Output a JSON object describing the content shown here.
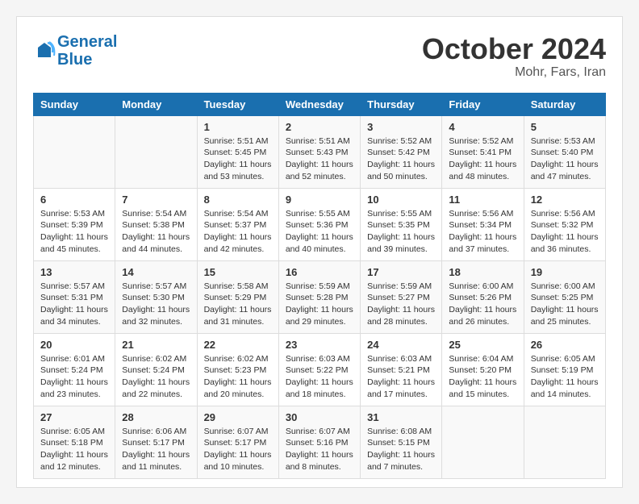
{
  "header": {
    "logo_general": "General",
    "logo_blue": "Blue",
    "month": "October 2024",
    "location": "Mohr, Fars, Iran"
  },
  "days_of_week": [
    "Sunday",
    "Monday",
    "Tuesday",
    "Wednesday",
    "Thursday",
    "Friday",
    "Saturday"
  ],
  "weeks": [
    [
      {
        "day": "",
        "info": ""
      },
      {
        "day": "",
        "info": ""
      },
      {
        "day": "1",
        "info": "Sunrise: 5:51 AM\nSunset: 5:45 PM\nDaylight: 11 hours\nand 53 minutes."
      },
      {
        "day": "2",
        "info": "Sunrise: 5:51 AM\nSunset: 5:43 PM\nDaylight: 11 hours\nand 52 minutes."
      },
      {
        "day": "3",
        "info": "Sunrise: 5:52 AM\nSunset: 5:42 PM\nDaylight: 11 hours\nand 50 minutes."
      },
      {
        "day": "4",
        "info": "Sunrise: 5:52 AM\nSunset: 5:41 PM\nDaylight: 11 hours\nand 48 minutes."
      },
      {
        "day": "5",
        "info": "Sunrise: 5:53 AM\nSunset: 5:40 PM\nDaylight: 11 hours\nand 47 minutes."
      }
    ],
    [
      {
        "day": "6",
        "info": "Sunrise: 5:53 AM\nSunset: 5:39 PM\nDaylight: 11 hours\nand 45 minutes."
      },
      {
        "day": "7",
        "info": "Sunrise: 5:54 AM\nSunset: 5:38 PM\nDaylight: 11 hours\nand 44 minutes."
      },
      {
        "day": "8",
        "info": "Sunrise: 5:54 AM\nSunset: 5:37 PM\nDaylight: 11 hours\nand 42 minutes."
      },
      {
        "day": "9",
        "info": "Sunrise: 5:55 AM\nSunset: 5:36 PM\nDaylight: 11 hours\nand 40 minutes."
      },
      {
        "day": "10",
        "info": "Sunrise: 5:55 AM\nSunset: 5:35 PM\nDaylight: 11 hours\nand 39 minutes."
      },
      {
        "day": "11",
        "info": "Sunrise: 5:56 AM\nSunset: 5:34 PM\nDaylight: 11 hours\nand 37 minutes."
      },
      {
        "day": "12",
        "info": "Sunrise: 5:56 AM\nSunset: 5:32 PM\nDaylight: 11 hours\nand 36 minutes."
      }
    ],
    [
      {
        "day": "13",
        "info": "Sunrise: 5:57 AM\nSunset: 5:31 PM\nDaylight: 11 hours\nand 34 minutes."
      },
      {
        "day": "14",
        "info": "Sunrise: 5:57 AM\nSunset: 5:30 PM\nDaylight: 11 hours\nand 32 minutes."
      },
      {
        "day": "15",
        "info": "Sunrise: 5:58 AM\nSunset: 5:29 PM\nDaylight: 11 hours\nand 31 minutes."
      },
      {
        "day": "16",
        "info": "Sunrise: 5:59 AM\nSunset: 5:28 PM\nDaylight: 11 hours\nand 29 minutes."
      },
      {
        "day": "17",
        "info": "Sunrise: 5:59 AM\nSunset: 5:27 PM\nDaylight: 11 hours\nand 28 minutes."
      },
      {
        "day": "18",
        "info": "Sunrise: 6:00 AM\nSunset: 5:26 PM\nDaylight: 11 hours\nand 26 minutes."
      },
      {
        "day": "19",
        "info": "Sunrise: 6:00 AM\nSunset: 5:25 PM\nDaylight: 11 hours\nand 25 minutes."
      }
    ],
    [
      {
        "day": "20",
        "info": "Sunrise: 6:01 AM\nSunset: 5:24 PM\nDaylight: 11 hours\nand 23 minutes."
      },
      {
        "day": "21",
        "info": "Sunrise: 6:02 AM\nSunset: 5:24 PM\nDaylight: 11 hours\nand 22 minutes."
      },
      {
        "day": "22",
        "info": "Sunrise: 6:02 AM\nSunset: 5:23 PM\nDaylight: 11 hours\nand 20 minutes."
      },
      {
        "day": "23",
        "info": "Sunrise: 6:03 AM\nSunset: 5:22 PM\nDaylight: 11 hours\nand 18 minutes."
      },
      {
        "day": "24",
        "info": "Sunrise: 6:03 AM\nSunset: 5:21 PM\nDaylight: 11 hours\nand 17 minutes."
      },
      {
        "day": "25",
        "info": "Sunrise: 6:04 AM\nSunset: 5:20 PM\nDaylight: 11 hours\nand 15 minutes."
      },
      {
        "day": "26",
        "info": "Sunrise: 6:05 AM\nSunset: 5:19 PM\nDaylight: 11 hours\nand 14 minutes."
      }
    ],
    [
      {
        "day": "27",
        "info": "Sunrise: 6:05 AM\nSunset: 5:18 PM\nDaylight: 11 hours\nand 12 minutes."
      },
      {
        "day": "28",
        "info": "Sunrise: 6:06 AM\nSunset: 5:17 PM\nDaylight: 11 hours\nand 11 minutes."
      },
      {
        "day": "29",
        "info": "Sunrise: 6:07 AM\nSunset: 5:17 PM\nDaylight: 11 hours\nand 10 minutes."
      },
      {
        "day": "30",
        "info": "Sunrise: 6:07 AM\nSunset: 5:16 PM\nDaylight: 11 hours\nand 8 minutes."
      },
      {
        "day": "31",
        "info": "Sunrise: 6:08 AM\nSunset: 5:15 PM\nDaylight: 11 hours\nand 7 minutes."
      },
      {
        "day": "",
        "info": ""
      },
      {
        "day": "",
        "info": ""
      }
    ]
  ]
}
